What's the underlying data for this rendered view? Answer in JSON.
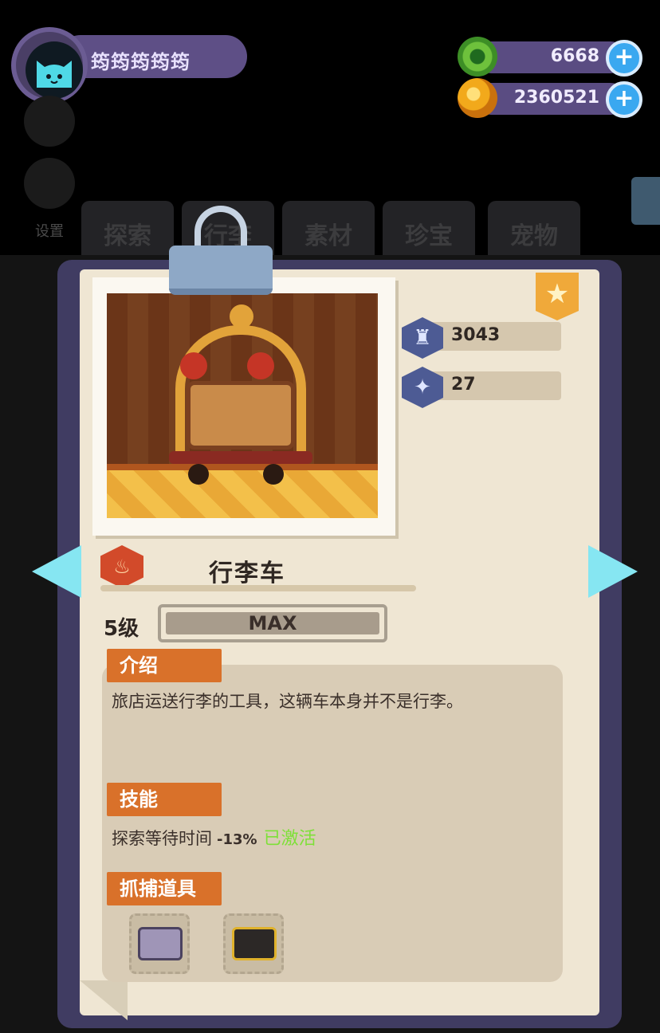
{
  "profile": {
    "name": "筠筠筠筠筠"
  },
  "currency": {
    "gems": {
      "value": "6668",
      "icon": "green-donut-gem-icon"
    },
    "gold": {
      "value": "2360521",
      "icon": "gold-planet-coin-icon"
    }
  },
  "side": {
    "settings_label": "设置"
  },
  "tabs": [
    "探索",
    "行李",
    "素材",
    "珍宝",
    "宠物"
  ],
  "card": {
    "name": "行李车",
    "power": "3043",
    "skill_power": "27",
    "level_label": "5级",
    "level_bar": "MAX",
    "level_progress": 1.0,
    "type_icon": "fire-hexagon-icon",
    "star_icon": "star-badge-icon"
  },
  "sections": {
    "intro_title": "介绍",
    "intro_text": "旅店运送行李的工具，这辆车本身并不是行李。",
    "skill_title": "技能",
    "skill_text": "探索等待时间",
    "skill_value": "-13%",
    "skill_status": "已激活",
    "tools_title": "抓捕道具"
  },
  "colors": {
    "accent": "#d9712a",
    "active": "#7ee038",
    "arrow": "#86e6f2",
    "book": "#403c62"
  }
}
